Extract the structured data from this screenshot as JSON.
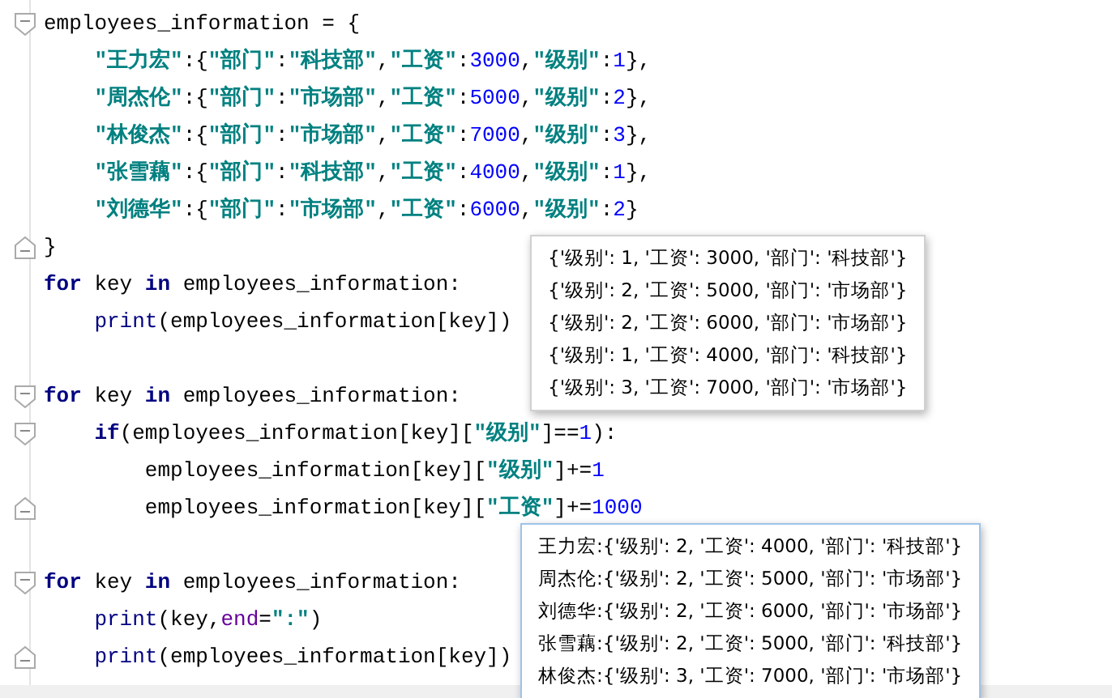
{
  "editor": {
    "lines": [
      {
        "kind": "code",
        "fold_start": true,
        "tokens": [
          {
            "kind": "text",
            "text": "employees_information = {"
          }
        ],
        "children": [
          {
            "kind": "code",
            "tokens": [
              {
                "kind": "string",
                "text": "\"王力宏\""
              },
              {
                "kind": "text",
                "text": ":{"
              },
              {
                "kind": "string",
                "text": "\"部门\""
              },
              {
                "kind": "text",
                "text": ":"
              },
              {
                "kind": "string",
                "text": "\"科技部\""
              },
              {
                "kind": "text",
                "text": ","
              },
              {
                "kind": "string",
                "text": "\"工资\""
              },
              {
                "kind": "text",
                "text": ":"
              },
              {
                "kind": "number",
                "text": "3000"
              },
              {
                "kind": "text",
                "text": ","
              },
              {
                "kind": "string",
                "text": "\"级别\""
              },
              {
                "kind": "text",
                "text": ":"
              },
              {
                "kind": "number",
                "text": "1"
              },
              {
                "kind": "text",
                "text": "},"
              }
            ]
          },
          {
            "kind": "code",
            "tokens": [
              {
                "kind": "string",
                "text": "\"周杰伦\""
              },
              {
                "kind": "text",
                "text": ":{"
              },
              {
                "kind": "string",
                "text": "\"部门\""
              },
              {
                "kind": "text",
                "text": ":"
              },
              {
                "kind": "string",
                "text": "\"市场部\""
              },
              {
                "kind": "text",
                "text": ","
              },
              {
                "kind": "string",
                "text": "\"工资\""
              },
              {
                "kind": "text",
                "text": ":"
              },
              {
                "kind": "number",
                "text": "5000"
              },
              {
                "kind": "text",
                "text": ","
              },
              {
                "kind": "string",
                "text": "\"级别\""
              },
              {
                "kind": "text",
                "text": ":"
              },
              {
                "kind": "number",
                "text": "2"
              },
              {
                "kind": "text",
                "text": "},"
              }
            ]
          },
          {
            "kind": "code",
            "tokens": [
              {
                "kind": "string",
                "text": "\"林俊杰\""
              },
              {
                "kind": "text",
                "text": ":{"
              },
              {
                "kind": "string",
                "text": "\"部门\""
              },
              {
                "kind": "text",
                "text": ":"
              },
              {
                "kind": "string",
                "text": "\"市场部\""
              },
              {
                "kind": "text",
                "text": ","
              },
              {
                "kind": "string",
                "text": "\"工资\""
              },
              {
                "kind": "text",
                "text": ":"
              },
              {
                "kind": "number",
                "text": "7000"
              },
              {
                "kind": "text",
                "text": ","
              },
              {
                "kind": "string",
                "text": "\"级别\""
              },
              {
                "kind": "text",
                "text": ":"
              },
              {
                "kind": "number",
                "text": "3"
              },
              {
                "kind": "text",
                "text": "},"
              }
            ]
          },
          {
            "kind": "code",
            "tokens": [
              {
                "kind": "string",
                "text": "\"张雪藕\""
              },
              {
                "kind": "text",
                "text": ":{"
              },
              {
                "kind": "string",
                "text": "\"部门\""
              },
              {
                "kind": "text",
                "text": ":"
              },
              {
                "kind": "string",
                "text": "\"科技部\""
              },
              {
                "kind": "text",
                "text": ","
              },
              {
                "kind": "string",
                "text": "\"工资\""
              },
              {
                "kind": "text",
                "text": ":"
              },
              {
                "kind": "number",
                "text": "4000"
              },
              {
                "kind": "text",
                "text": ","
              },
              {
                "kind": "string",
                "text": "\"级别\""
              },
              {
                "kind": "text",
                "text": ":"
              },
              {
                "kind": "number",
                "text": "1"
              },
              {
                "kind": "text",
                "text": "},"
              }
            ]
          },
          {
            "kind": "code",
            "tokens": [
              {
                "kind": "string",
                "text": "\"刘德华\""
              },
              {
                "kind": "text",
                "text": ":{"
              },
              {
                "kind": "string",
                "text": "\"部门\""
              },
              {
                "kind": "text",
                "text": ":"
              },
              {
                "kind": "string",
                "text": "\"市场部\""
              },
              {
                "kind": "text",
                "text": ","
              },
              {
                "kind": "string",
                "text": "\"工资\""
              },
              {
                "kind": "text",
                "text": ":"
              },
              {
                "kind": "number",
                "text": "6000"
              },
              {
                "kind": "text",
                "text": ","
              },
              {
                "kind": "string",
                "text": "\"级别\""
              },
              {
                "kind": "text",
                "text": ":"
              },
              {
                "kind": "number",
                "text": "2"
              },
              {
                "kind": "text",
                "text": "}"
              }
            ]
          }
        ]
      },
      {
        "kind": "code",
        "fold_end": true,
        "tokens": [
          {
            "kind": "text",
            "text": "}"
          }
        ]
      },
      {
        "kind": "code",
        "tokens": [
          {
            "kind": "keyword",
            "text": "for"
          },
          {
            "kind": "text",
            "text": " key "
          },
          {
            "kind": "keyword",
            "text": "in"
          },
          {
            "kind": "text",
            "text": " employees_information:"
          }
        ],
        "children": [
          {
            "kind": "code",
            "tokens": [
              {
                "kind": "builtin",
                "text": "print"
              },
              {
                "kind": "text",
                "text": "(employees_information[key])"
              }
            ]
          }
        ]
      },
      {
        "kind": "blank"
      },
      {
        "kind": "code",
        "fold_start": true,
        "tokens": [
          {
            "kind": "keyword",
            "text": "for"
          },
          {
            "kind": "text",
            "text": " key "
          },
          {
            "kind": "keyword",
            "text": "in"
          },
          {
            "kind": "text",
            "text": " employees_information:"
          }
        ],
        "children": [
          {
            "kind": "code",
            "fold_start": true,
            "tokens": [
              {
                "kind": "keyword",
                "text": "if"
              },
              {
                "kind": "text",
                "text": "(employees_information[key]["
              },
              {
                "kind": "string",
                "text": "\"级别\""
              },
              {
                "kind": "text",
                "text": "]=="
              },
              {
                "kind": "number",
                "text": "1"
              },
              {
                "kind": "text",
                "text": "):"
              }
            ],
            "children": [
              {
                "kind": "code",
                "tokens": [
                  {
                    "kind": "text",
                    "text": "employees_information[key]["
                  },
                  {
                    "kind": "string",
                    "text": "\"级别\""
                  },
                  {
                    "kind": "text",
                    "text": "]+="
                  },
                  {
                    "kind": "number",
                    "text": "1"
                  }
                ]
              },
              {
                "kind": "code",
                "fold_end": true,
                "tokens": [
                  {
                    "kind": "text",
                    "text": "employees_information[key]["
                  },
                  {
                    "kind": "string",
                    "text": "\"工资\""
                  },
                  {
                    "kind": "text",
                    "text": "]+="
                  },
                  {
                    "kind": "number",
                    "text": "1000"
                  }
                ]
              }
            ]
          }
        ]
      },
      {
        "kind": "blank"
      },
      {
        "kind": "code",
        "fold_start": true,
        "tokens": [
          {
            "kind": "keyword",
            "text": "for"
          },
          {
            "kind": "text",
            "text": " key "
          },
          {
            "kind": "keyword",
            "text": "in"
          },
          {
            "kind": "text",
            "text": " employees_information:"
          }
        ],
        "children": [
          {
            "kind": "code",
            "tokens": [
              {
                "kind": "builtin",
                "text": "print"
              },
              {
                "kind": "text",
                "text": "(key,"
              },
              {
                "kind": "param",
                "text": "end"
              },
              {
                "kind": "text",
                "text": "="
              },
              {
                "kind": "string",
                "text": "\":\""
              },
              {
                "kind": "text",
                "text": ")"
              }
            ]
          },
          {
            "kind": "code",
            "fold_end": true,
            "tokens": [
              {
                "kind": "builtin",
                "text": "print"
              },
              {
                "kind": "text",
                "text": "(employees_information[key])"
              }
            ]
          }
        ]
      }
    ]
  },
  "outputs": [
    {
      "lines": [
        "{'级别': 1, '工资': 3000, '部门': '科技部'}",
        "{'级别': 2, '工资': 5000, '部门': '市场部'}",
        "{'级别': 2, '工资': 6000, '部门': '市场部'}",
        "{'级别': 1, '工资': 4000, '部门': '科技部'}",
        "{'级别': 3, '工资': 7000, '部门': '市场部'}"
      ]
    },
    {
      "lines": [
        "王力宏:{'级别': 2, '工资': 4000, '部门': '科技部'}",
        "周杰伦:{'级别': 2, '工资': 5000, '部门': '市场部'}",
        "刘德华:{'级别': 2, '工资': 6000, '部门': '市场部'}",
        "张雪藕:{'级别': 2, '工资': 5000, '部门': '科技部'}",
        "林俊杰:{'级别': 3, '工资': 7000, '部门': '市场部'}"
      ]
    }
  ]
}
